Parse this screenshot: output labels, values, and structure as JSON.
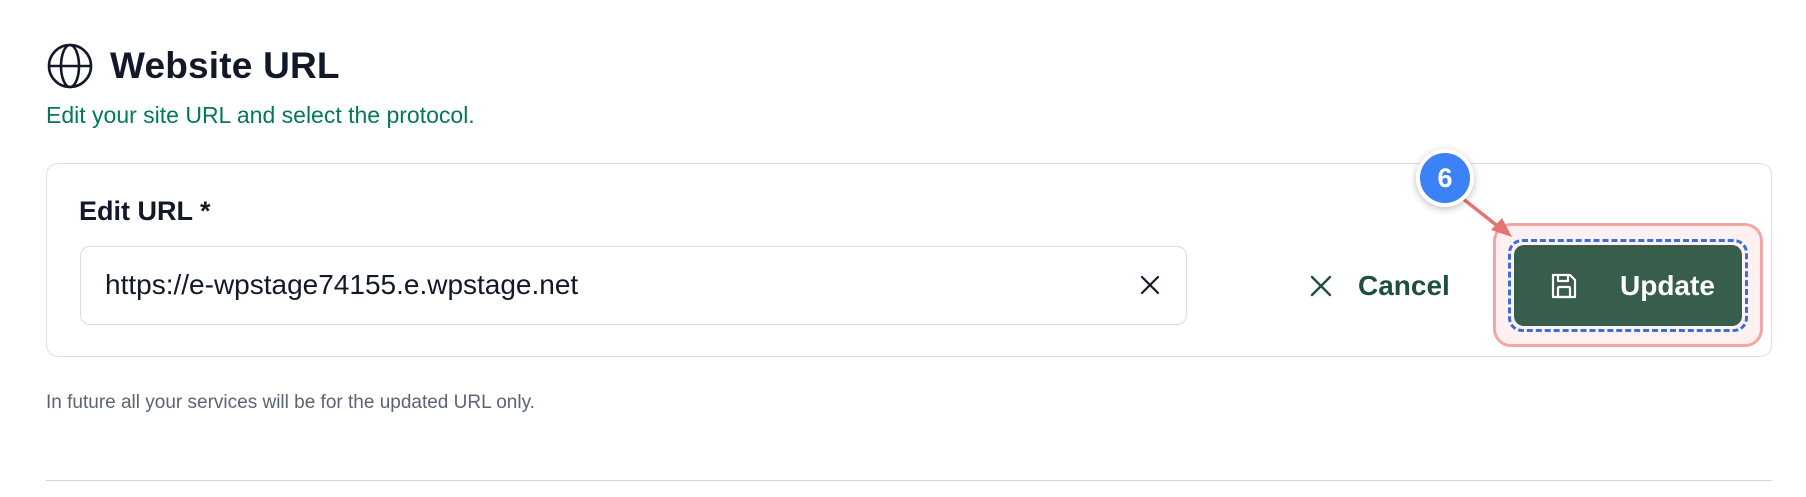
{
  "header": {
    "icon": "globe-icon",
    "title": "Website URL",
    "subtitle": "Edit your site URL and select the protocol."
  },
  "form": {
    "label": "Edit URL *",
    "url_value": "https://e-wpstage74155.e.wpstage.net",
    "clear_icon": "close-icon",
    "cancel_label": "Cancel",
    "cancel_icon": "close-icon",
    "update_label": "Update",
    "update_icon": "save-icon"
  },
  "annotation": {
    "step_number": "6"
  },
  "note": "In future all your services will be for the updated URL only.",
  "colors": {
    "subtitle": "#047857",
    "primary_button": "#375d4b",
    "cancel_text": "#1f4f3d",
    "step_badge": "#3b82f6",
    "highlight_border": "#f6a5a5",
    "focus_dash": "#3b6fd8"
  }
}
